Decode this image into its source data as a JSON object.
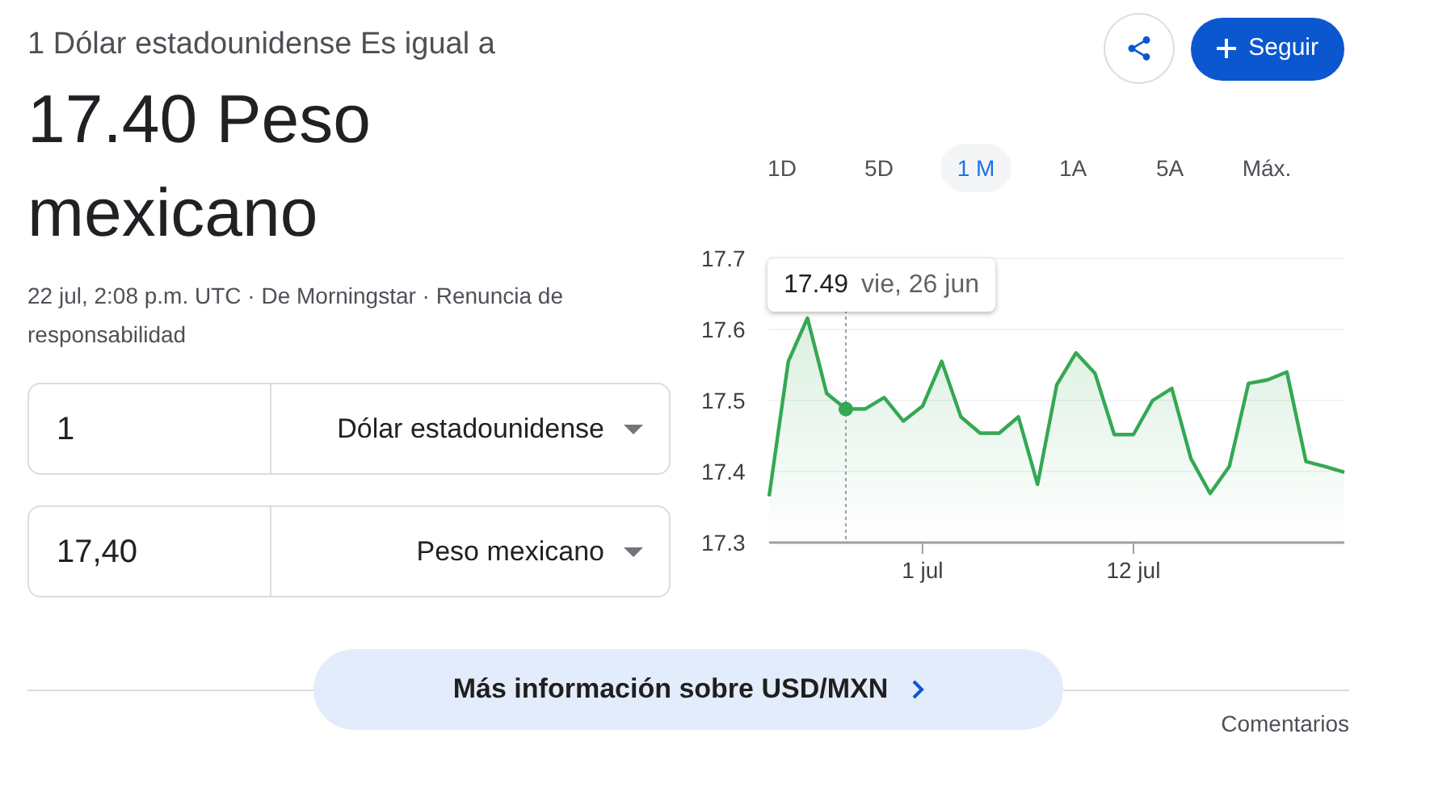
{
  "header": "1 Dólar estadounidense Es igual a",
  "rate": "17.40 Peso mexicano",
  "meta": "22 jul, 2:08 p.m. UTC · De Morningstar · Renuncia de responsabilidad",
  "converter": [
    {
      "amount": "1",
      "currency": "Dólar estadounidense"
    },
    {
      "amount": "17,40",
      "currency": "Peso mexicano"
    }
  ],
  "follow_button": "Seguir",
  "ranges": [
    {
      "label": "1D",
      "selected": false
    },
    {
      "label": "5D",
      "selected": false
    },
    {
      "label": "1 M",
      "selected": true
    },
    {
      "label": "1A",
      "selected": false
    },
    {
      "label": "5A",
      "selected": false
    },
    {
      "label": "Máx.",
      "selected": false
    }
  ],
  "chart": {
    "tooltip": {
      "value": "17.49",
      "date": "vie, 26 jun"
    },
    "chart_data": {
      "type": "area",
      "categories": [
        null,
        null,
        null,
        null,
        null,
        null,
        null,
        null,
        "1 jul",
        null,
        null,
        null,
        null,
        null,
        null,
        null,
        null,
        null,
        null,
        "12 jul",
        null,
        null,
        null,
        null,
        null,
        null,
        null,
        null,
        null,
        null,
        null
      ],
      "series": [
        {
          "color": "#34a853",
          "values": [
            17.365,
            17.555,
            17.616,
            17.51,
            17.488,
            17.488,
            17.504,
            17.471,
            17.492,
            17.555,
            17.477,
            17.454,
            17.454,
            17.477,
            17.382,
            17.522,
            17.567,
            17.538,
            17.452,
            17.452,
            17.5,
            17.517,
            17.418,
            17.369,
            17.407,
            17.524,
            17.529,
            17.54,
            17.414,
            17.407,
            17.399
          ]
        }
      ],
      "ylim": [
        17.3,
        17.7
      ],
      "yticks": [
        17.3,
        17.4,
        17.5,
        17.6,
        17.7
      ],
      "grid": true
    }
  },
  "more_info_button": "Más información sobre USD/MXN",
  "feedback": "Comentarios"
}
